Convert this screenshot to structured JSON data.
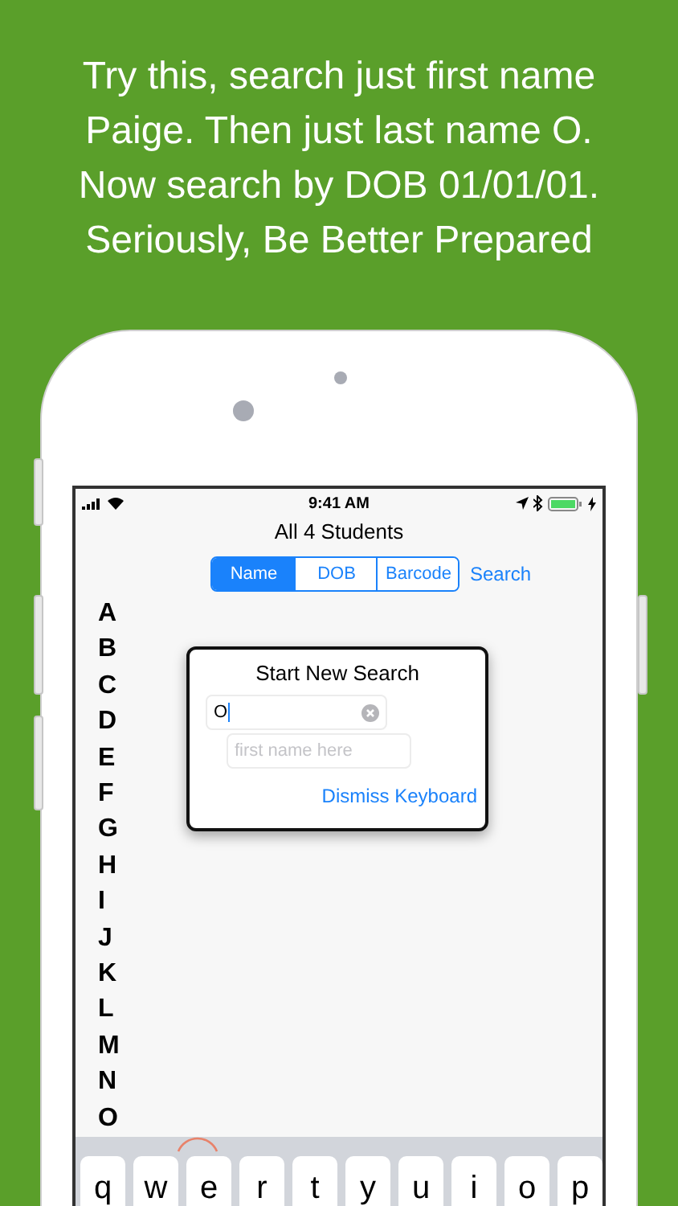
{
  "caption": "Try this, search just first name\nPaige. Then just last name O.\nNow search by DOB 01/01/01.\nSeriously, Be Better Prepared",
  "status_bar": {
    "time": "9:41 AM"
  },
  "title": "All 4 Students",
  "segments": [
    {
      "label": "Name",
      "selected": true
    },
    {
      "label": "DOB",
      "selected": false
    },
    {
      "label": "Barcode",
      "selected": false
    }
  ],
  "search_link": "Search",
  "index_letters": [
    "A",
    "B",
    "C",
    "D",
    "E",
    "F",
    "G",
    "H",
    "I",
    "J",
    "K",
    "L",
    "M",
    "N",
    "O"
  ],
  "dialog": {
    "title": "Start New Search",
    "fields": [
      {
        "value": "O",
        "clear_button": true
      },
      {
        "placeholder": "first name here",
        "clear_button": false
      }
    ],
    "link": "Dismiss Keyboard"
  },
  "keyboard": {
    "keys": [
      "q",
      "w",
      "e",
      "r",
      "t",
      "y",
      "u",
      "i",
      "o",
      "p"
    ]
  }
}
